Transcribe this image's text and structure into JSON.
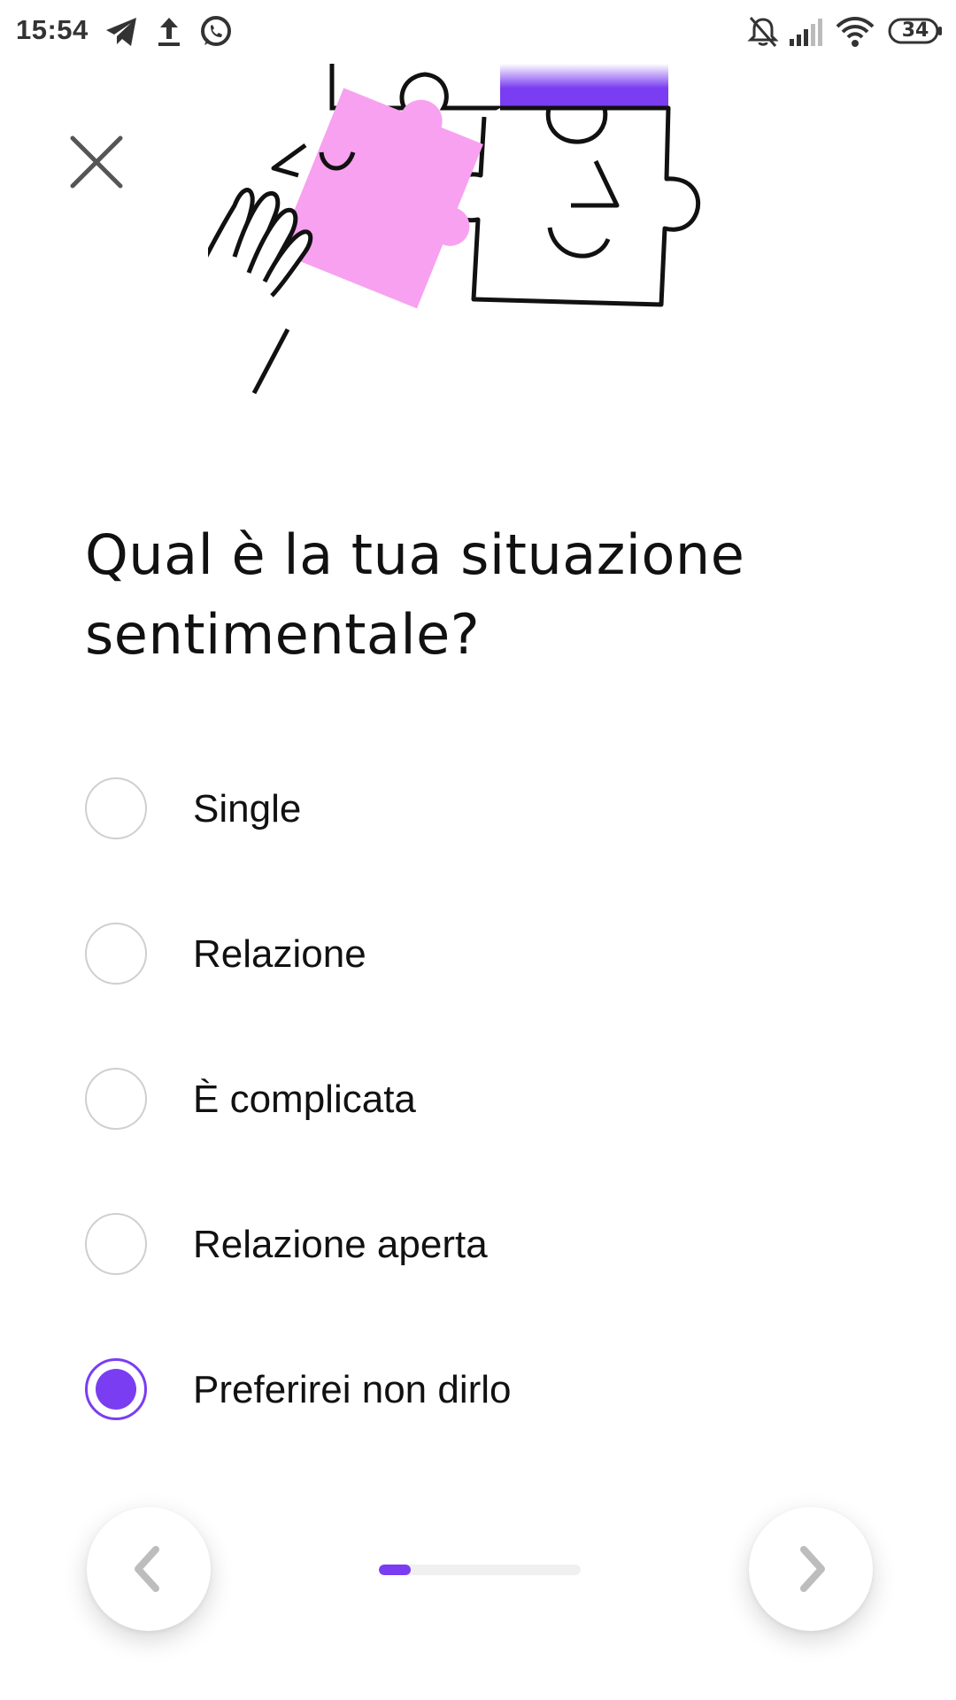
{
  "status_bar": {
    "time": "15:54",
    "left_icons": [
      "telegram-icon",
      "upload-icon",
      "whatsapp-icon"
    ],
    "right_icons": [
      "notifications-off-icon",
      "cellular-signal-icon",
      "wifi-icon",
      "battery-icon"
    ],
    "battery_level": "34"
  },
  "header": {
    "close_icon": "close-icon"
  },
  "illustration": {
    "description_icon": "puzzle-hand-illustration"
  },
  "question": {
    "title": "Qual è la tua situazione sentimentale?"
  },
  "options": [
    {
      "label": "Single",
      "selected": false
    },
    {
      "label": "Relazione",
      "selected": false
    },
    {
      "label": "È complicata",
      "selected": false
    },
    {
      "label": "Relazione aperta",
      "selected": false
    },
    {
      "label": "Preferirei non dirlo",
      "selected": true
    }
  ],
  "navigation": {
    "prev_icon": "chevron-left-icon",
    "next_icon": "chevron-right-icon",
    "progress_fraction": 0.16
  },
  "colors": {
    "accent": "#7a3df2",
    "pink": "#f7a1f0",
    "radio_border": "#cfcfcf",
    "text": "#111111"
  }
}
